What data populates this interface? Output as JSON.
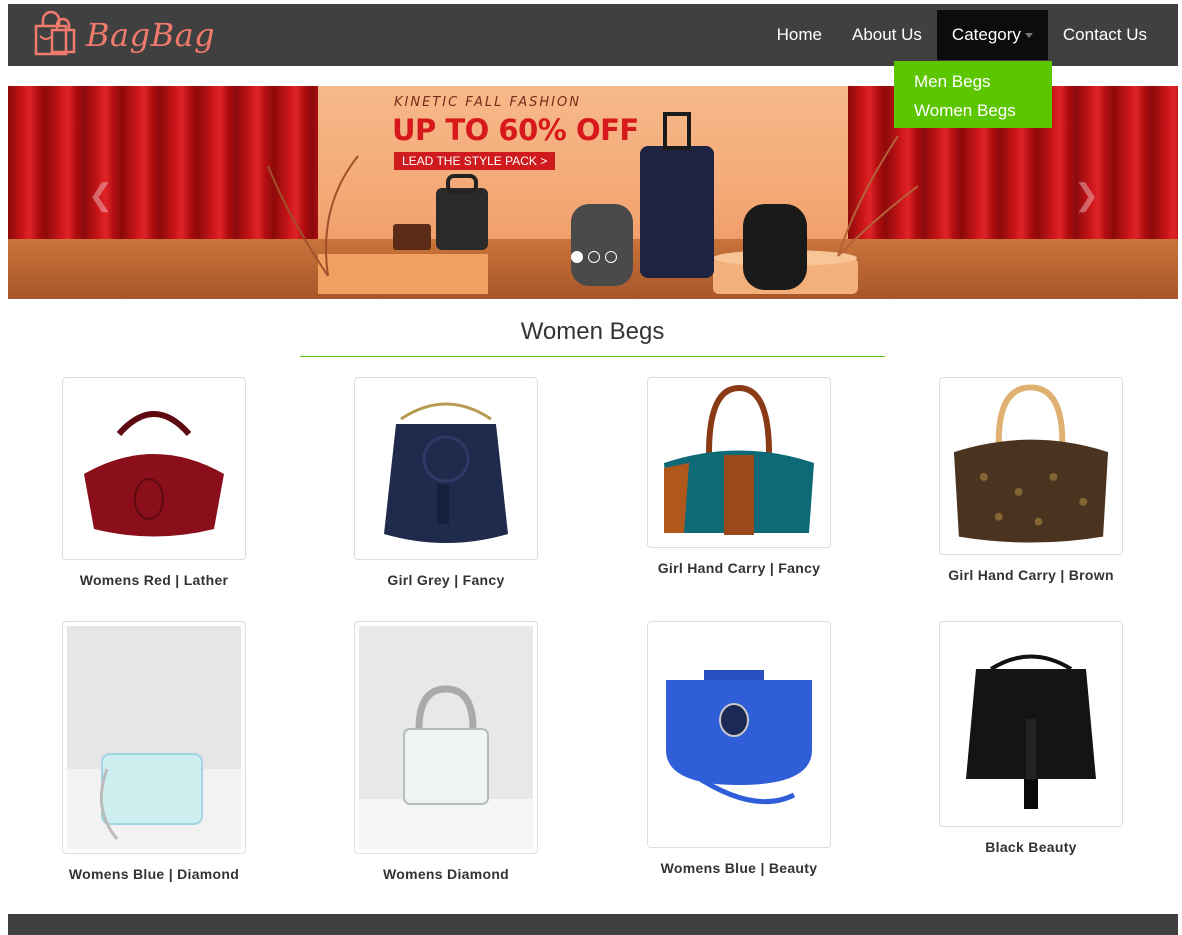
{
  "brand": {
    "name": "BagBag",
    "logo_color": "#f07b6c"
  },
  "nav": {
    "items": [
      {
        "label": "Home"
      },
      {
        "label": "About Us"
      },
      {
        "label": "Category"
      },
      {
        "label": "Contact Us"
      }
    ],
    "active": "Category",
    "background": "#404040"
  },
  "dropdown": {
    "items": [
      {
        "label": "Men Begs"
      },
      {
        "label": "Women Begs"
      }
    ],
    "background": "#5cc600"
  },
  "carousel": {
    "kicker": "KINETIC FALL FASHION",
    "headline": "UP TO 60% OFF",
    "cta": "LEAD THE STYLE PACK >",
    "slides_count": 3,
    "active_slide": 1
  },
  "section": {
    "title": "Women Begs",
    "accent": "#5cc600"
  },
  "products": [
    {
      "name": "Womens Red | Lather"
    },
    {
      "name": "Girl Grey | Fancy"
    },
    {
      "name": "Girl Hand Carry | Fancy"
    },
    {
      "name": "Girl Hand Carry | Brown"
    },
    {
      "name": "Womens Blue | Diamond"
    },
    {
      "name": "Womens Diamond"
    },
    {
      "name": "Womens Blue | Beauty"
    },
    {
      "name": "Black Beauty"
    }
  ]
}
